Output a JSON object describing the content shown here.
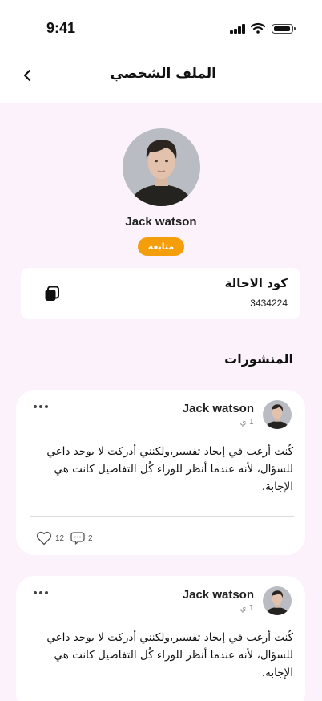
{
  "status_bar": {
    "time": "9:41",
    "icons": [
      "signal-icon",
      "wifi-icon",
      "battery-icon"
    ]
  },
  "header": {
    "title": "الملف الشخصي",
    "back_icon": "chevron-left-icon"
  },
  "profile": {
    "name": "Jack watson",
    "follow_label": "متابعة",
    "accent_color": "#f59e0b"
  },
  "referral": {
    "title": "كود الاحالة",
    "code": "3434224",
    "copy_icon": "copy-icon"
  },
  "posts_section": {
    "title": "المنشورات"
  },
  "posts": [
    {
      "author": "Jack watson",
      "time": "1 ي",
      "text": "كُنت أرغب في إيجاد تفسير،ولكنني أدركت لا يوجد داعي للسؤال، لأنه عندما أنظر للوراء كُل التفاصيل كانت هي الإجابة.",
      "likes": "12",
      "comments": "2"
    },
    {
      "author": "Jack watson",
      "time": "1 ي",
      "text": "كُنت أرغب في إيجاد تفسير،ولكنني أدركت لا يوجد داعي للسؤال، لأنه عندما أنظر للوراء كُل التفاصيل كانت هي الإجابة."
    }
  ],
  "colors": {
    "background": "#fbf2fc",
    "card": "#ffffff"
  }
}
